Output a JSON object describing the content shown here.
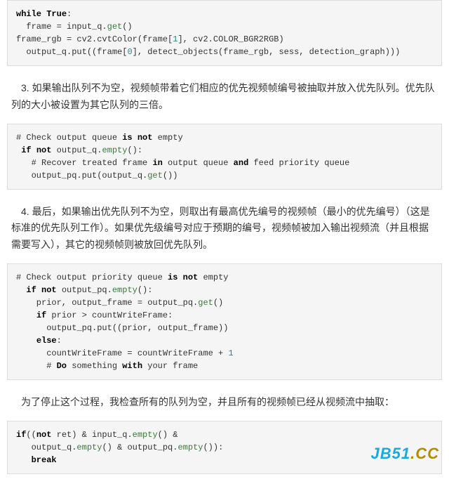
{
  "code1": {
    "l1a": "while",
    "l1b": "True",
    "l1c": ":",
    "l2a": "  frame = input_q.",
    "l2b": "get",
    "l2c": "()",
    "l3a": "frame_rgb = cv2.cvtColor(frame[",
    "l3b": "1",
    "l3c": "], cv2.COLOR_BGR2RGB)",
    "l4a": "  output_q.put((frame[",
    "l4b": "0",
    "l4c": "], detect_objects(frame_rgb, sess, detection_graph)))"
  },
  "para1": "　3. 如果输出队列不为空，视频帧带着它们相应的优先视频帧编号被抽取并放入优先队列。优先队列的大小被设置为其它队列的三倍。",
  "code2": {
    "l1a": "# Check output queue ",
    "l1b": "is",
    "l1c": " ",
    "l1d": "not",
    "l1e": " empty",
    "l2a": " ",
    "l2b": "if",
    "l2c": " ",
    "l2d": "not",
    "l2e": " output_q.",
    "l2f": "empty",
    "l2g": "():",
    "l3a": "   # Recover treated frame ",
    "l3b": "in",
    "l3c": " output queue ",
    "l3d": "and",
    "l3e": " feed priority queue",
    "l4a": "   output_pq.put(output_q.",
    "l4b": "get",
    "l4c": "())"
  },
  "para2": "　4. 最后，如果输出优先队列不为空，则取出有最高优先编号的视频帧（最小的优先编号）（这是标准的优先队列工作）。如果优先级编号对应于预期的编号，视频帧被加入输出视频流（并且根据需要写入），其它的视频帧则被放回优先队列。",
  "code3": {
    "l1a": "# Check output priority queue ",
    "l1b": "is",
    "l1c": " ",
    "l1d": "not",
    "l1e": " empty",
    "l2a": "  ",
    "l2b": "if",
    "l2c": " ",
    "l2d": "not",
    "l2e": " output_pq.",
    "l2f": "empty",
    "l2g": "():",
    "l3a": "    prior, output_frame = output_pq.",
    "l3b": "get",
    "l3c": "()",
    "l4a": "    ",
    "l4b": "if",
    "l4c": " prior > countWriteFrame:",
    "l5a": "      output_pq.put((prior, output_frame))",
    "l6a": "    ",
    "l6b": "else",
    "l6c": ":",
    "l7a": "      countWriteFrame = countWriteFrame + ",
    "l7b": "1",
    "l8a": "      # ",
    "l8b": "Do",
    "l8c": " something ",
    "l8d": "with",
    "l8e": " your frame"
  },
  "para3": "　为了停止这个过程，我检查所有的队列为空，并且所有的视频帧已经从视频流中抽取：",
  "code4": {
    "l1a": "if",
    "l1b": "((",
    "l1c": "not",
    "l1d": " ret) & input_q.",
    "l1e": "empty",
    "l1f": "() &",
    "l2a": "   output_q.",
    "l2b": "empty",
    "l2c": "() & output_pq.",
    "l2d": "empty",
    "l2e": "()):",
    "l3a": "   ",
    "l3b": "break"
  },
  "watermark": {
    "blue": "JB51",
    "gold": ".CC"
  }
}
